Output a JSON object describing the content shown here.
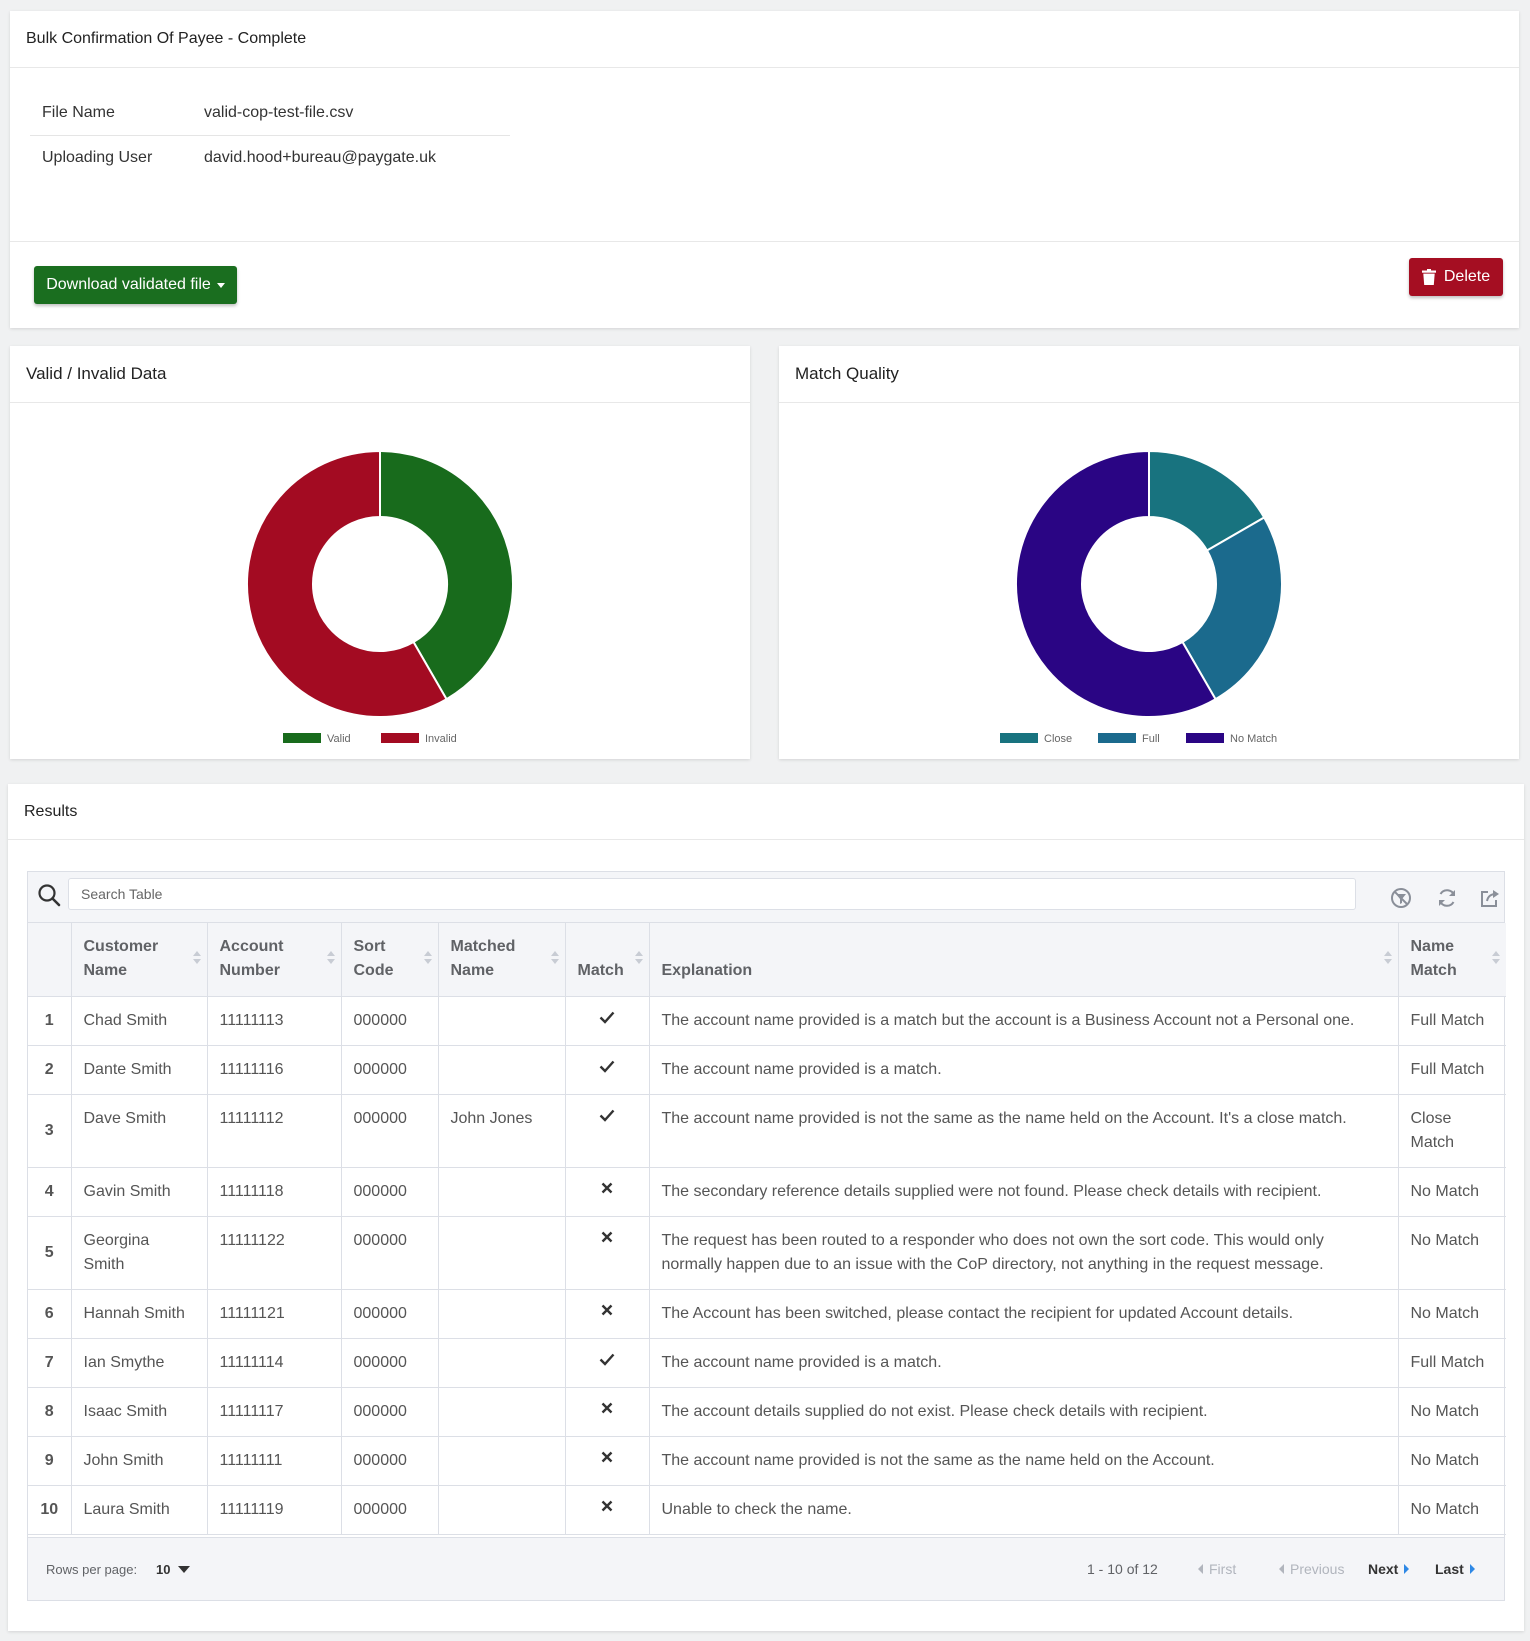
{
  "header": {
    "title": "Bulk Confirmation Of Payee - Complete"
  },
  "file_info": {
    "file_name_label": "File Name",
    "file_name_value": "valid-cop-test-file.csv",
    "user_label": "Uploading User",
    "user_value": "david.hood+bureau@paygate.uk"
  },
  "actions": {
    "download_label": "Download validated file",
    "delete_label": "Delete"
  },
  "colors": {
    "valid": "#186b1c",
    "invalid": "#a30b22",
    "close": "#18737f",
    "full": "#1b6a8d",
    "no_match": "#2a0584",
    "primary_button": "#1a6e1f",
    "danger_button": "#a50e22"
  },
  "chart_data": [
    {
      "type": "pie",
      "title": "Valid / Invalid Data",
      "labels": [
        "Valid",
        "Invalid"
      ],
      "values": [
        5,
        7
      ],
      "colors": [
        "#186b1c",
        "#a30b22"
      ],
      "legend": "bottom"
    },
    {
      "type": "pie",
      "title": "Match Quality",
      "labels": [
        "Close",
        "Full",
        "No Match"
      ],
      "values": [
        2,
        3,
        7
      ],
      "colors": [
        "#18737f",
        "#1b6a8d",
        "#2a0584"
      ],
      "legend": "bottom"
    }
  ],
  "results": {
    "title": "Results",
    "search_placeholder": "Search Table",
    "columns": [
      {
        "line1": "Customer",
        "line2": "Name"
      },
      {
        "line1": "Account",
        "line2": "Number"
      },
      {
        "line1": "Sort",
        "line2": "Code"
      },
      {
        "line1": "Matched",
        "line2": "Name"
      },
      {
        "line1": "",
        "line2": "Match"
      },
      {
        "line1": "",
        "line2": "Explanation"
      },
      {
        "line1": "Name",
        "line2": "Match"
      }
    ],
    "rows": [
      {
        "index": "1",
        "customer_name": "Chad Smith",
        "account_number": "11111113",
        "sort_code": "000000",
        "matched_name": "",
        "match": "check",
        "explanation": "The account name provided is a match but the account is a Business Account not a Personal one.",
        "name_match": "Full Match"
      },
      {
        "index": "2",
        "customer_name": "Dante Smith",
        "account_number": "11111116",
        "sort_code": "000000",
        "matched_name": "",
        "match": "check",
        "explanation": "The account name provided is a match.",
        "name_match": "Full Match"
      },
      {
        "index": "3",
        "customer_name": "Dave Smith",
        "account_number": "11111112",
        "sort_code": "000000",
        "matched_name": "John Jones",
        "match": "check",
        "explanation": "The account name provided is not the same as the name held on the Account. It's a close match.",
        "name_match": "Close Match"
      },
      {
        "index": "4",
        "customer_name": "Gavin Smith",
        "account_number": "11111118",
        "sort_code": "000000",
        "matched_name": "",
        "match": "cross",
        "explanation": "The secondary reference details supplied were not found. Please check details with recipient.",
        "name_match": "No Match"
      },
      {
        "index": "5",
        "customer_name": "Georgina Smith",
        "account_number": "11111122",
        "sort_code": "000000",
        "matched_name": "",
        "match": "cross",
        "explanation": "The request has been routed to a responder who does not own the sort code. This would only normally happen due to an issue with the CoP directory, not anything in the request message.",
        "name_match": "No Match"
      },
      {
        "index": "6",
        "customer_name": "Hannah Smith",
        "account_number": "11111121",
        "sort_code": "000000",
        "matched_name": "",
        "match": "cross",
        "explanation": "The Account has been switched, please contact the recipient for updated Account details.",
        "name_match": "No Match"
      },
      {
        "index": "7",
        "customer_name": "Ian Smythe",
        "account_number": "11111114",
        "sort_code": "000000",
        "matched_name": "",
        "match": "check",
        "explanation": "The account name provided is a match.",
        "name_match": "Full Match"
      },
      {
        "index": "8",
        "customer_name": "Isaac Smith",
        "account_number": "11111117",
        "sort_code": "000000",
        "matched_name": "",
        "match": "cross",
        "explanation": "The account details supplied do not exist. Please check details with recipient.",
        "name_match": "No Match"
      },
      {
        "index": "9",
        "customer_name": "John Smith",
        "account_number": "11111111",
        "sort_code": "000000",
        "matched_name": "",
        "match": "cross",
        "explanation": "The account name provided is not the same as the name held on the Account.",
        "name_match": "No Match"
      },
      {
        "index": "10",
        "customer_name": "Laura Smith",
        "account_number": "11111119",
        "sort_code": "000000",
        "matched_name": "",
        "match": "cross",
        "explanation": "Unable to check the name.",
        "name_match": "No Match"
      }
    ],
    "pagination": {
      "rows_per_page_label": "Rows per page:",
      "rows_per_page_value": "10",
      "range_text": "1 - 10 of 12",
      "first_label": "First",
      "previous_label": "Previous",
      "next_label": "Next",
      "last_label": "Last"
    }
  }
}
